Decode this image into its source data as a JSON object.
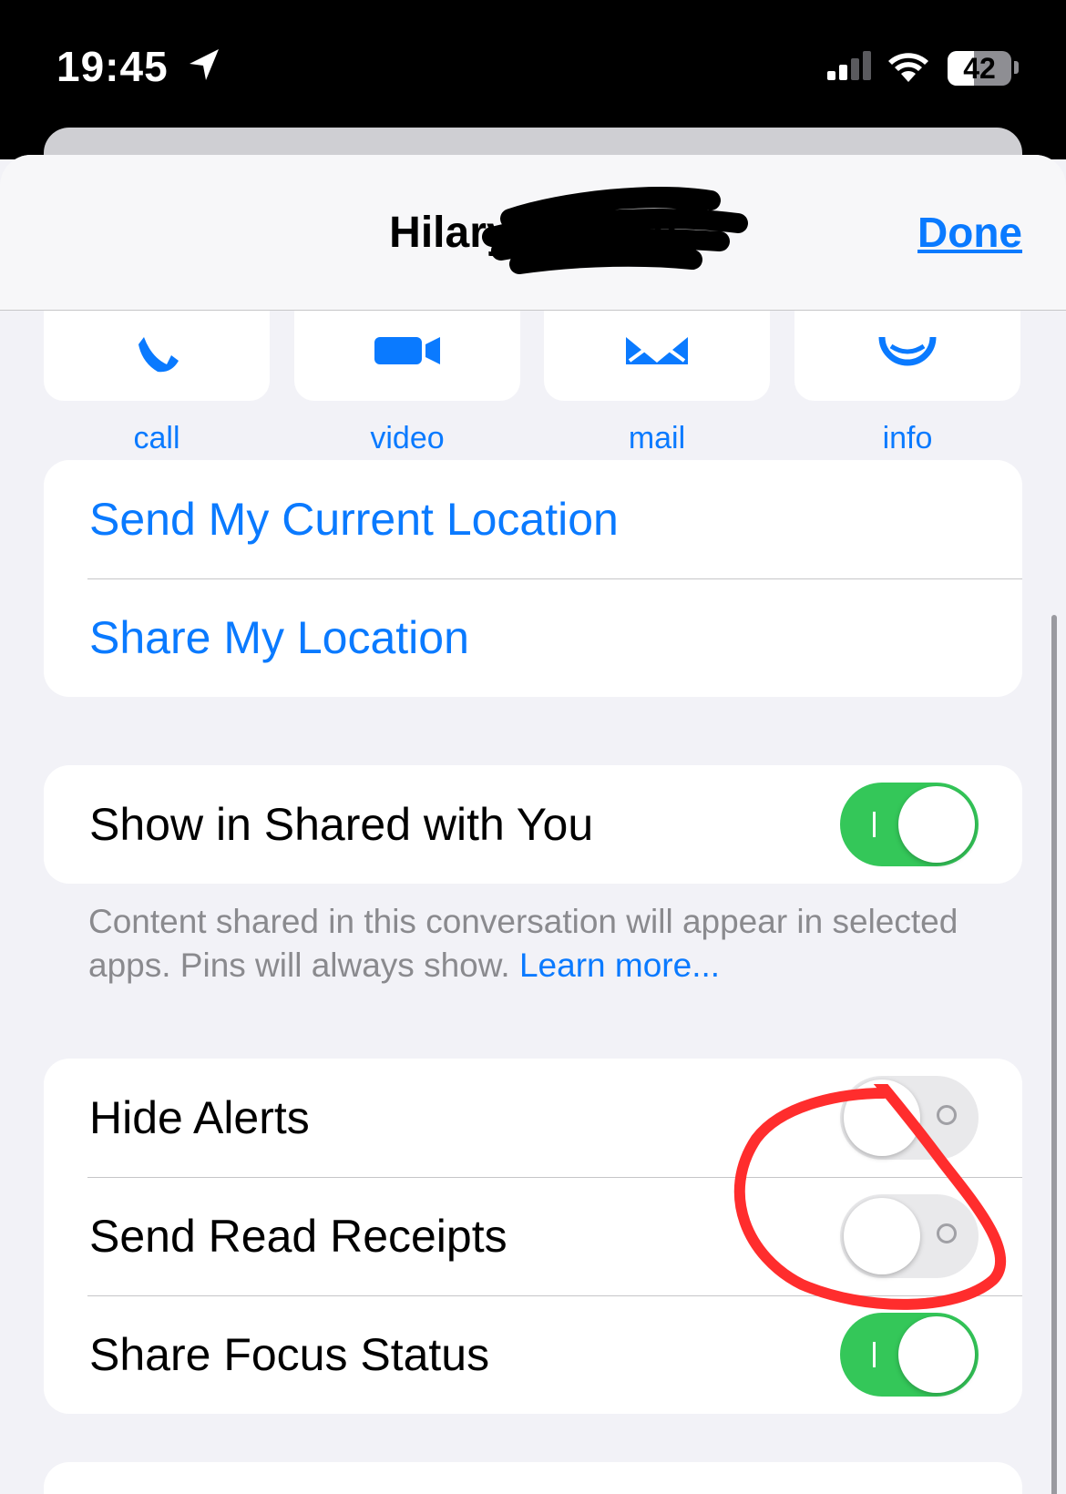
{
  "status_bar": {
    "time": "19:45",
    "battery": "42",
    "icons": [
      "location-arrow-icon",
      "cellular-signal-icon",
      "wifi-icon",
      "battery-icon"
    ]
  },
  "nav": {
    "title": "Hilary Watney",
    "done_label": "Done"
  },
  "actions": [
    {
      "label": "call",
      "icon": "phone-icon"
    },
    {
      "label": "video",
      "icon": "video-camera-icon"
    },
    {
      "label": "mail",
      "icon": "envelope-icon"
    },
    {
      "label": "info",
      "icon": "person-icon"
    }
  ],
  "location_group": {
    "send_current": "Send My Current Location",
    "share_location": "Share My Location"
  },
  "shared_with_you": {
    "label": "Show in Shared with You",
    "enabled": true,
    "footnote_text": "Content shared in this conversation will appear in selected apps. Pins will always show.",
    "footnote_link": "Learn more..."
  },
  "settings_group": {
    "hide_alerts": {
      "label": "Hide Alerts",
      "enabled": false
    },
    "read_receipts": {
      "label": "Send Read Receipts",
      "enabled": false
    },
    "focus_status": {
      "label": "Share Focus Status",
      "enabled": true
    }
  },
  "colors": {
    "accent": "#0a7aff",
    "toggle_on": "#34c759",
    "annotation": "#ff2d2d"
  }
}
